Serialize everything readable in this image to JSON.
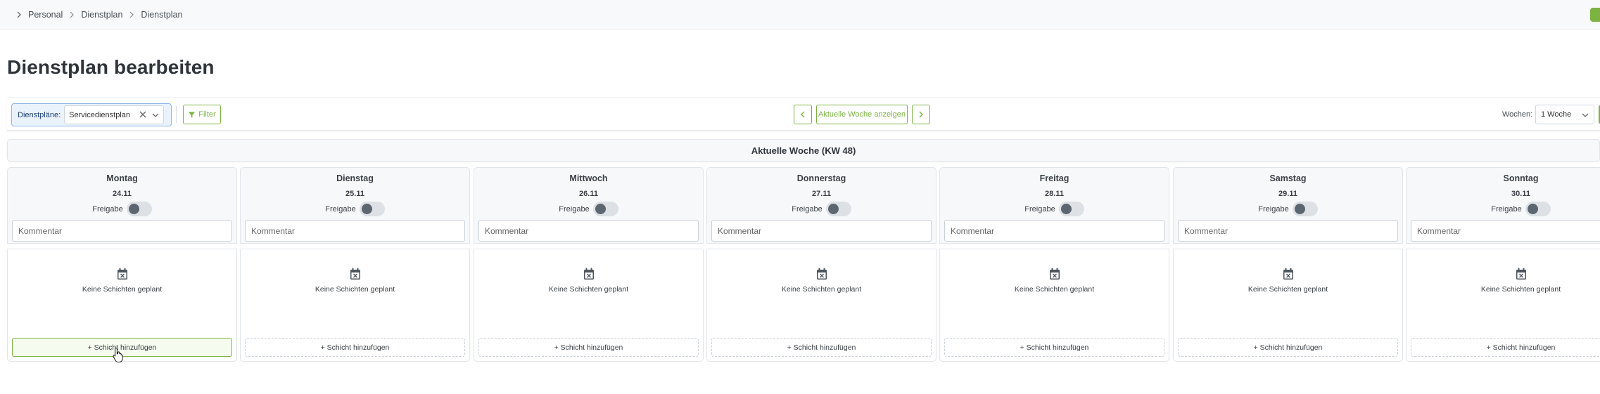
{
  "breadcrumb": [
    "Personal",
    "Dienstplan",
    "Dienstplan"
  ],
  "page_title": "Dienstplan bearbeiten",
  "toolbar": {
    "plans_label": "Dienstpläne:",
    "plans_value": "Servicedienstplan",
    "filter_label": "Filter",
    "current_week_label": "Aktuelle Woche anzeigen",
    "weeks_label": "Wochen:",
    "weeks_value": "1 Woche"
  },
  "week_header": "Aktuelle Woche (KW 48)",
  "days": [
    {
      "name": "Montag",
      "date": "24.11",
      "release_label": "Freigabe",
      "comment_placeholder": "Kommentar",
      "empty_text": "Keine Schichten geplant",
      "add_label": "+ Schicht hinzufügen"
    },
    {
      "name": "Dienstag",
      "date": "25.11",
      "release_label": "Freigabe",
      "comment_placeholder": "Kommentar",
      "empty_text": "Keine Schichten geplant",
      "add_label": "+ Schicht hinzufügen"
    },
    {
      "name": "Mittwoch",
      "date": "26.11",
      "release_label": "Freigabe",
      "comment_placeholder": "Kommentar",
      "empty_text": "Keine Schichten geplant",
      "add_label": "+ Schicht hinzufügen"
    },
    {
      "name": "Donnerstag",
      "date": "27.11",
      "release_label": "Freigabe",
      "comment_placeholder": "Kommentar",
      "empty_text": "Keine Schichten geplant",
      "add_label": "+ Schicht hinzufügen"
    },
    {
      "name": "Freitag",
      "date": "28.11",
      "release_label": "Freigabe",
      "comment_placeholder": "Kommentar",
      "empty_text": "Keine Schichten geplant",
      "add_label": "+ Schicht hinzufügen"
    },
    {
      "name": "Samstag",
      "date": "29.11",
      "release_label": "Freigabe",
      "comment_placeholder": "Kommentar",
      "empty_text": "Keine Schichten geplant",
      "add_label": "+ Schicht hinzufügen"
    },
    {
      "name": "Sonntag",
      "date": "30.11",
      "release_label": "Freigabe",
      "comment_placeholder": "Kommentar",
      "empty_text": "Keine Schichten geplant",
      "add_label": "+ Schicht hinzufügen"
    }
  ],
  "colors": {
    "accent": "#7cb342",
    "toggle_off": "#dde1e6",
    "toggle_knob": "#5c6670",
    "select_highlight": "#eaf2fc"
  },
  "icons": [
    "chevron-right-icon",
    "filter-icon",
    "clear-icon",
    "chevron-down-icon",
    "chevron-left-icon",
    "calendar-x-icon",
    "hand-pointer-icon"
  ]
}
